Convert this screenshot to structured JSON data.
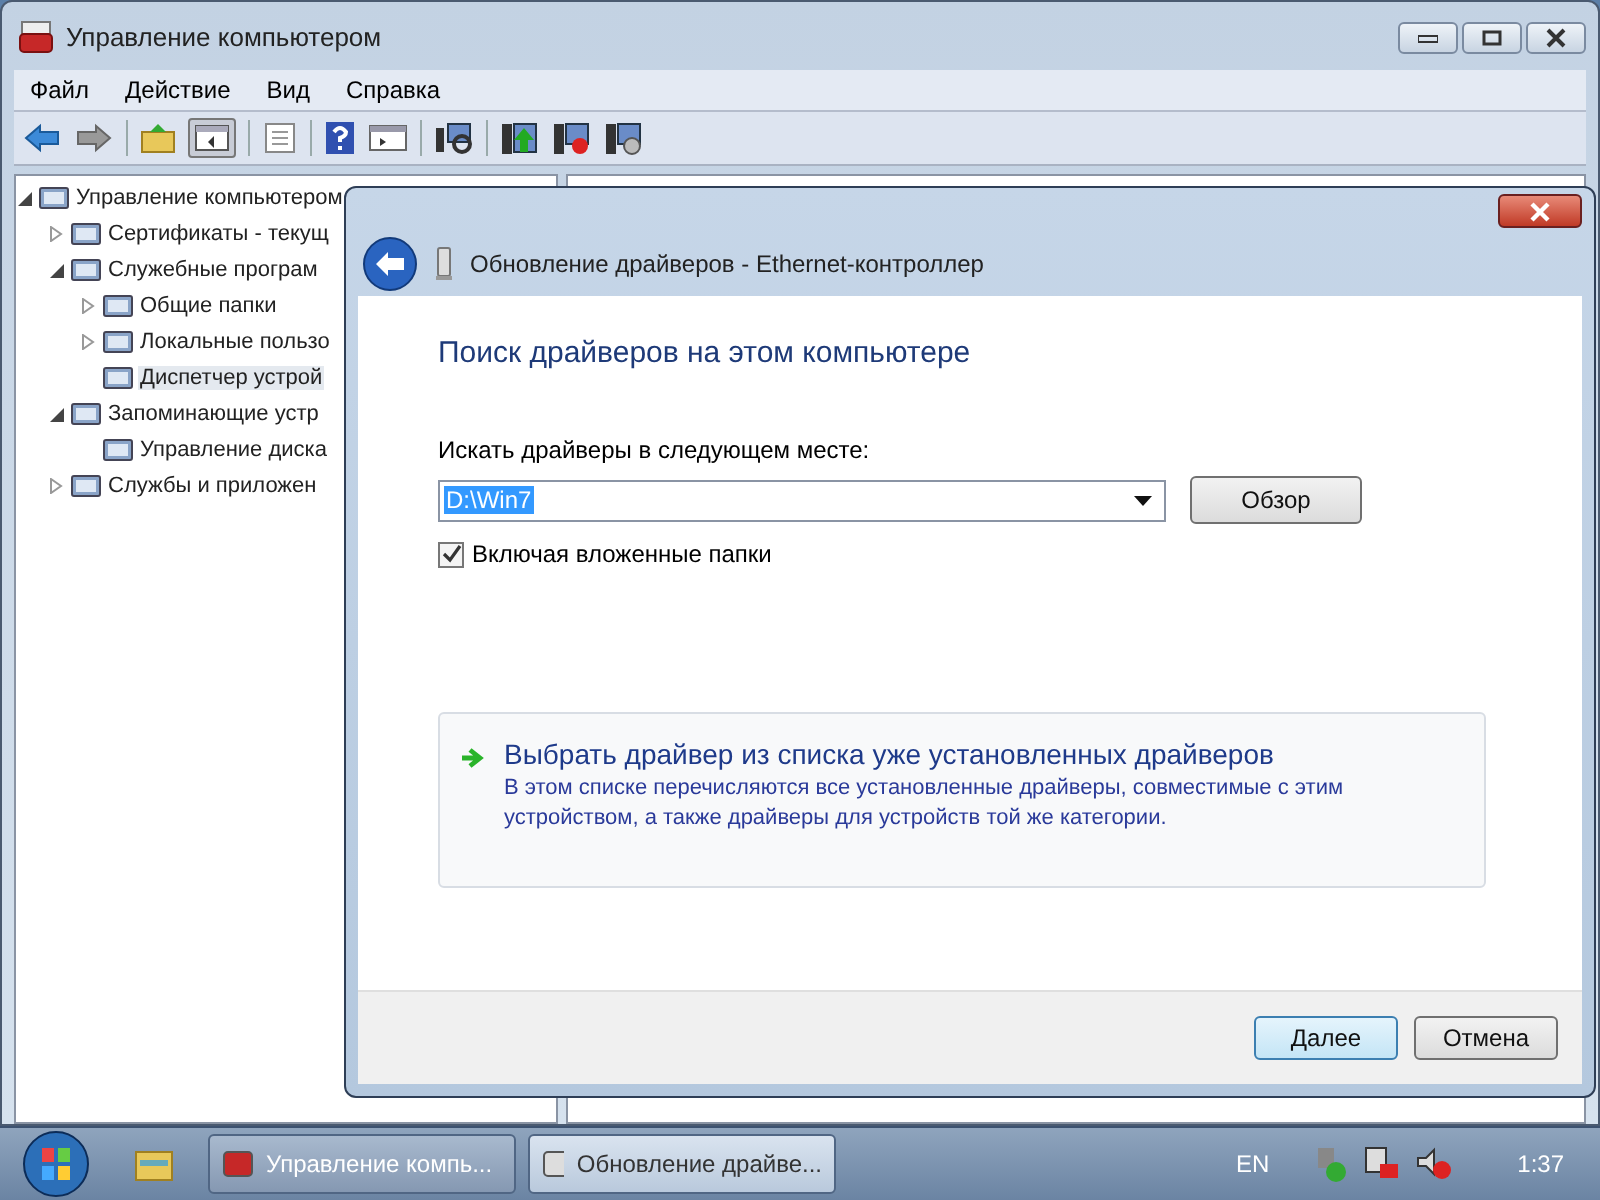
{
  "window": {
    "title": "Управление компьютером"
  },
  "menu": [
    "Файл",
    "Действие",
    "Вид",
    "Справка"
  ],
  "tree": [
    {
      "label": "Управление компьютером",
      "expanded": true,
      "children": [
        {
          "label": "Сертификаты - текущ",
          "expanded": false
        },
        {
          "label": "Служебные програм",
          "expanded": true,
          "children": [
            {
              "label": "Общие папки",
              "expanded": false
            },
            {
              "label": "Локальные пользо",
              "expanded": false
            },
            {
              "label": "Диспетчер устрой",
              "selected": true
            }
          ]
        },
        {
          "label": "Запоминающие устр",
          "expanded": true,
          "children": [
            {
              "label": "Управление диска",
              "selected": false
            }
          ]
        },
        {
          "label": "Службы и приложен",
          "expanded": false
        }
      ]
    }
  ],
  "dialog": {
    "title": "Обновление драйверов - Ethernet-контроллер",
    "heading": "Поиск драйверов на этом компьютере",
    "location_label": "Искать драйверы в следующем месте:",
    "location_value": "D:\\Win7",
    "browse_button": "Обзор",
    "include_subfolders": {
      "label": "Включая вложенные папки",
      "checked": true
    },
    "option": {
      "title": "Выбрать драйвер из списка уже установленных драйверов",
      "description": "В этом списке перечисляются все установленные драйверы, совместимые с этим устройством, а также драйверы для устройств той же категории."
    },
    "buttons": [
      {
        "label": "Далее",
        "default": true
      },
      {
        "label": "Отмена",
        "default": false
      }
    ]
  },
  "taskbar": {
    "tasks": [
      {
        "label": "Управление компь...",
        "selected": false
      },
      {
        "label": "Обновление драйве...",
        "selected": true
      }
    ],
    "language": "EN",
    "clock": "1:37"
  }
}
